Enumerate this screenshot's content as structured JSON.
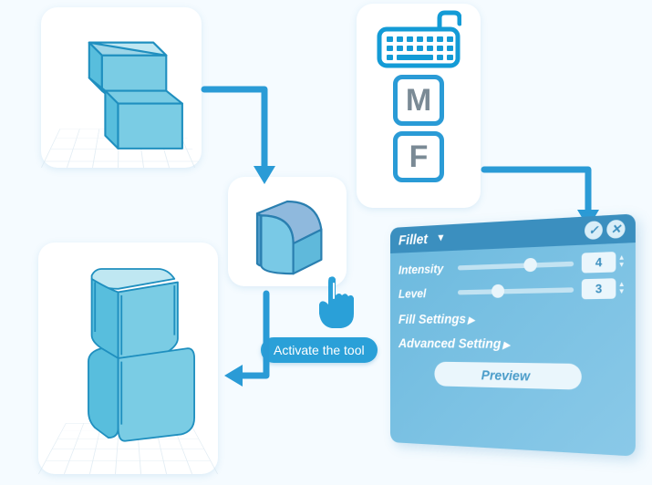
{
  "keys": {
    "key1": "M",
    "key2": "F"
  },
  "activate_label": "Activate the tool",
  "panel": {
    "title": "Fillet",
    "rows": {
      "intensity": {
        "label": "Intensity",
        "value": "4",
        "thumb_pct": 58
      },
      "level": {
        "label": "Level",
        "value": "3",
        "thumb_pct": 30
      }
    },
    "sections": {
      "fill": "Fill Settings",
      "advanced": "Advanced Setting"
    },
    "preview_label": "Preview"
  }
}
